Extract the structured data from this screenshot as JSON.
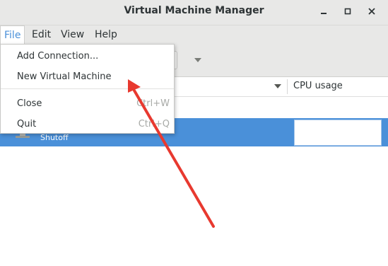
{
  "window": {
    "title": "Virtual Machine Manager",
    "controls": [
      "minimize",
      "maximize",
      "close"
    ]
  },
  "menubar": {
    "items": [
      {
        "label": "File"
      },
      {
        "label": "Edit"
      },
      {
        "label": "View"
      },
      {
        "label": "Help"
      }
    ]
  },
  "file_menu": {
    "items": [
      {
        "label": "Add Connection...",
        "accel": ""
      },
      {
        "label": "New Virtual Machine",
        "accel": ""
      },
      {
        "label": "Close",
        "accel": "Ctrl+W"
      },
      {
        "label": "Quit",
        "accel": "Ctrl+Q"
      }
    ]
  },
  "table": {
    "columns": [
      {
        "label": "CPU usage"
      }
    ],
    "rows": [
      {
        "status": "Shutoff",
        "selected": true
      }
    ]
  },
  "colors": {
    "accent": "#4a90d9",
    "annotation_arrow": "#e8392f"
  }
}
